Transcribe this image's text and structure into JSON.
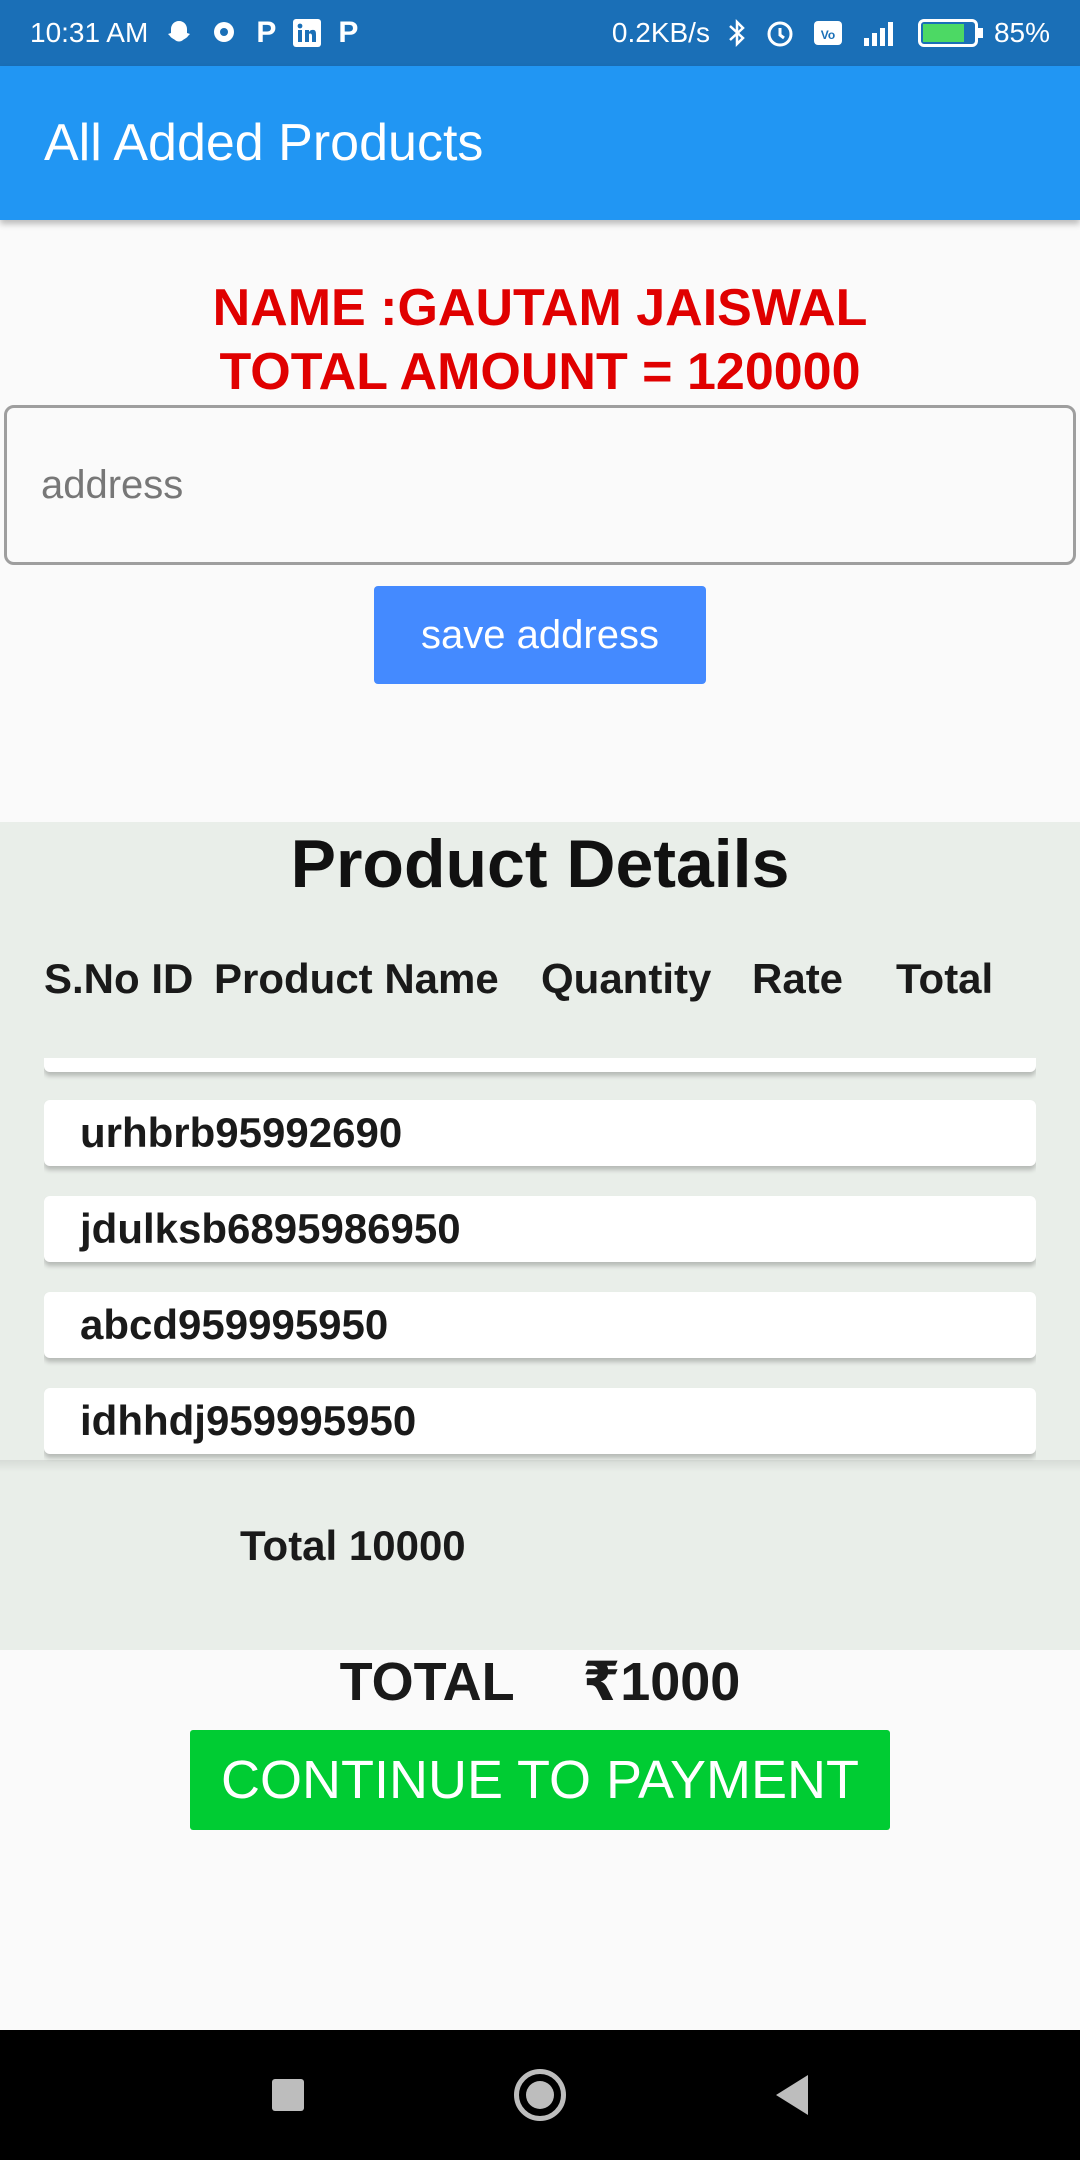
{
  "status_bar": {
    "time": "10:31 AM",
    "network_speed": "0.2KB/s",
    "battery": "85%",
    "battery_level": 0.85,
    "icons": [
      "snapchat-icon",
      "chat-icon",
      "paytm-icon",
      "linkedin-icon",
      "paytm-icon",
      "bluetooth-icon",
      "alarm-icon",
      "volte-icon",
      "signal-icon",
      "battery-icon"
    ]
  },
  "app_bar": {
    "title": "All Added Products"
  },
  "header": {
    "name_line": "NAME :GAUTAM JAISWAL",
    "amount_line": "TOTAL AMOUNT = 120000"
  },
  "address": {
    "placeholder": "address",
    "value": ""
  },
  "save_button": {
    "label": "save address"
  },
  "details": {
    "title": "Product Details",
    "columns": [
      "S.No ID",
      "Product Name",
      "Quantity",
      "Rate",
      "Total"
    ],
    "rows": [
      "urhbrb95992690",
      "jdulksb6895986950",
      "abcd959995950",
      "idhhdj959995950"
    ],
    "subtotal": "Total 10000"
  },
  "grand_total": {
    "label": "TOTAL",
    "amount": "₹1000"
  },
  "pay_button": {
    "label": "CONTINUE TO PAYMENT"
  },
  "colors": {
    "status_bar": "#1a6fb7",
    "app_bar": "#2196f3",
    "header_text": "#e00000",
    "save_button": "#448aff",
    "pay_button": "#00cc33",
    "details_bg": "#e9eee9"
  }
}
